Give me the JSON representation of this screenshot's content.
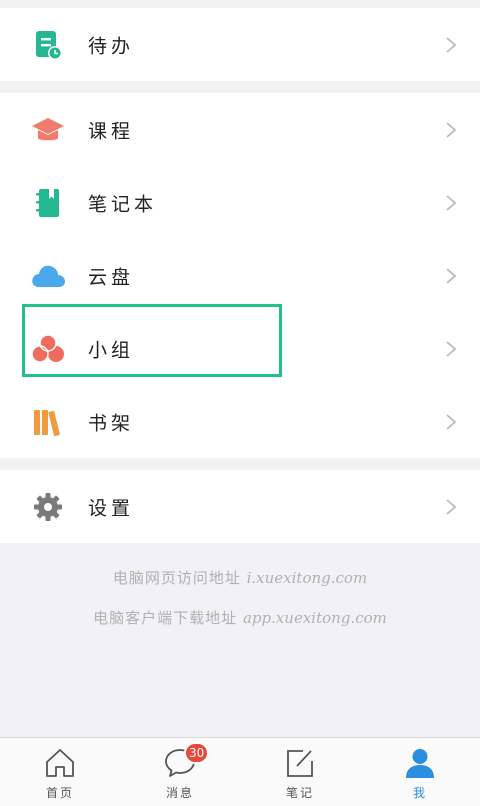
{
  "menu": {
    "todo": {
      "label": "待办",
      "icon": "todo-clock-icon",
      "color": "#23b891"
    },
    "course": {
      "label": "课程",
      "icon": "graduation-cap-icon",
      "color": "#f07a6e"
    },
    "notebook": {
      "label": "笔记本",
      "icon": "notebook-icon",
      "color": "#23b891"
    },
    "cloud": {
      "label": "云盘",
      "icon": "cloud-icon",
      "color": "#4aa9ec"
    },
    "group": {
      "label": "小组",
      "icon": "group-circles-icon",
      "color": "#f06a5e"
    },
    "bookshelf": {
      "label": "书架",
      "icon": "bookshelf-icon",
      "color": "#f19a3e"
    },
    "settings": {
      "label": "设置",
      "icon": "gear-icon",
      "color": "#7a7a7a"
    }
  },
  "footer": {
    "web_label": "电脑网页访问地址",
    "web_url": "i.xuexitong.com",
    "client_label": "电脑客户端下载地址",
    "client_url": "app.xuexitong.com"
  },
  "tabbar": {
    "home": "首页",
    "messages": "消息",
    "messages_badge": "30",
    "notes": "笔记",
    "me": "我",
    "active_color": "#2a8fe0"
  }
}
